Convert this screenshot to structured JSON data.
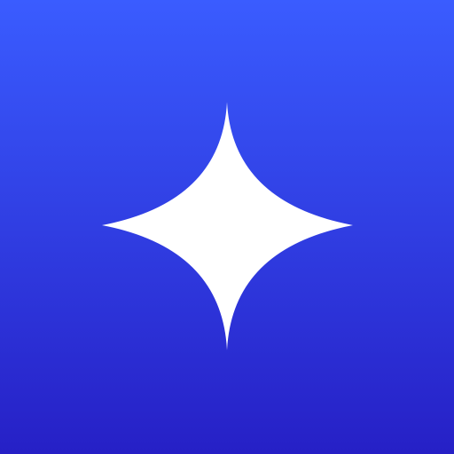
{
  "icon": {
    "name": "sparkle-icon",
    "colors": {
      "gradient_top": "#3a5cff",
      "gradient_bottom": "#2620c6",
      "glyph": "#ffffff"
    }
  }
}
